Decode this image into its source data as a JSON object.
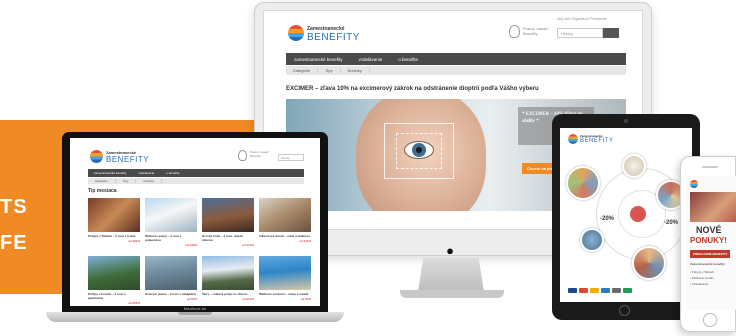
{
  "background_words": {
    "line1": "TS",
    "line2": "FE"
  },
  "site": {
    "logo_line1": "Zamestnanecké",
    "logo_line2": "BENEFITY",
    "tagline": "Pracuj. nasaď. Benefity",
    "search_placeholder": "Hľadaj",
    "search_button": "",
    "top_links": "Môj účet   Registrácia   Prihlásenie"
  },
  "imac": {
    "nav": [
      "zamestnanecké benefity",
      "vzdelávanie",
      "o benefite"
    ],
    "subnav": [
      "Kategórie",
      "Tipy",
      "Novinky"
    ],
    "headline": "EXCIMER – zľava 10% na excimerový zákrok na odstránenie dioptrií podľa Vášho výberu",
    "hero_panel": "* EXCIMER – 10% zľava na služby *",
    "hero_button": "Chcem sa prihlásiť"
  },
  "macbook": {
    "nav": [
      "zamestnanecké benefity",
      "vzdelávanie",
      "o benefite"
    ],
    "subnav": [
      "Kategórie",
      "Tipy",
      "Novinky"
    ],
    "section_title": "Tip mesiaca",
    "label": "MacBook Air",
    "tiles": [
      {
        "caption": "Pobyty v Tatrách – 3 noci v hoteli",
        "price": "od 199 €"
      },
      {
        "caption": "Wellness pobyt – 2 noci s polpenziou",
        "price": "od 149 €"
      },
      {
        "caption": "Horský hotel – 3 noci, skipas zdarma",
        "price": "od 179 €"
      },
      {
        "caption": "Víkend pre dvoch – relax a wellness",
        "price": "od 129 €"
      },
      {
        "caption": "Pobyty v horách – 5 nocí v apartmáne",
        "price": "od 259 €"
      },
      {
        "caption": "Hotel pri jazere – 2 noci s raňajkami",
        "price": "od 99 €"
      },
      {
        "caption": "Tatry – rodinný pobyt so zľavou",
        "price": "od 219 €"
      },
      {
        "caption": "Wellness centrum – vstup a masáž",
        "price": "od 39 €"
      }
    ]
  },
  "ipad": {
    "badge_left": "-20%",
    "badge_right": "-20%"
  },
  "phone": {
    "title_line1": "NOVÉ",
    "title_line2": "PONUKY!",
    "subtitle": "Zamestnanecké benefity",
    "button": "PREHĽADNÉ BENEFITY",
    "items": [
      "• Pobyty v Tatrách",
      "• Wellness a relax",
      "• Vzdelávanie"
    ]
  },
  "colors": {
    "accent_orange": "#f08a24",
    "nav_dark": "#4a4a4a",
    "brand_blue": "#2b6cb0"
  }
}
